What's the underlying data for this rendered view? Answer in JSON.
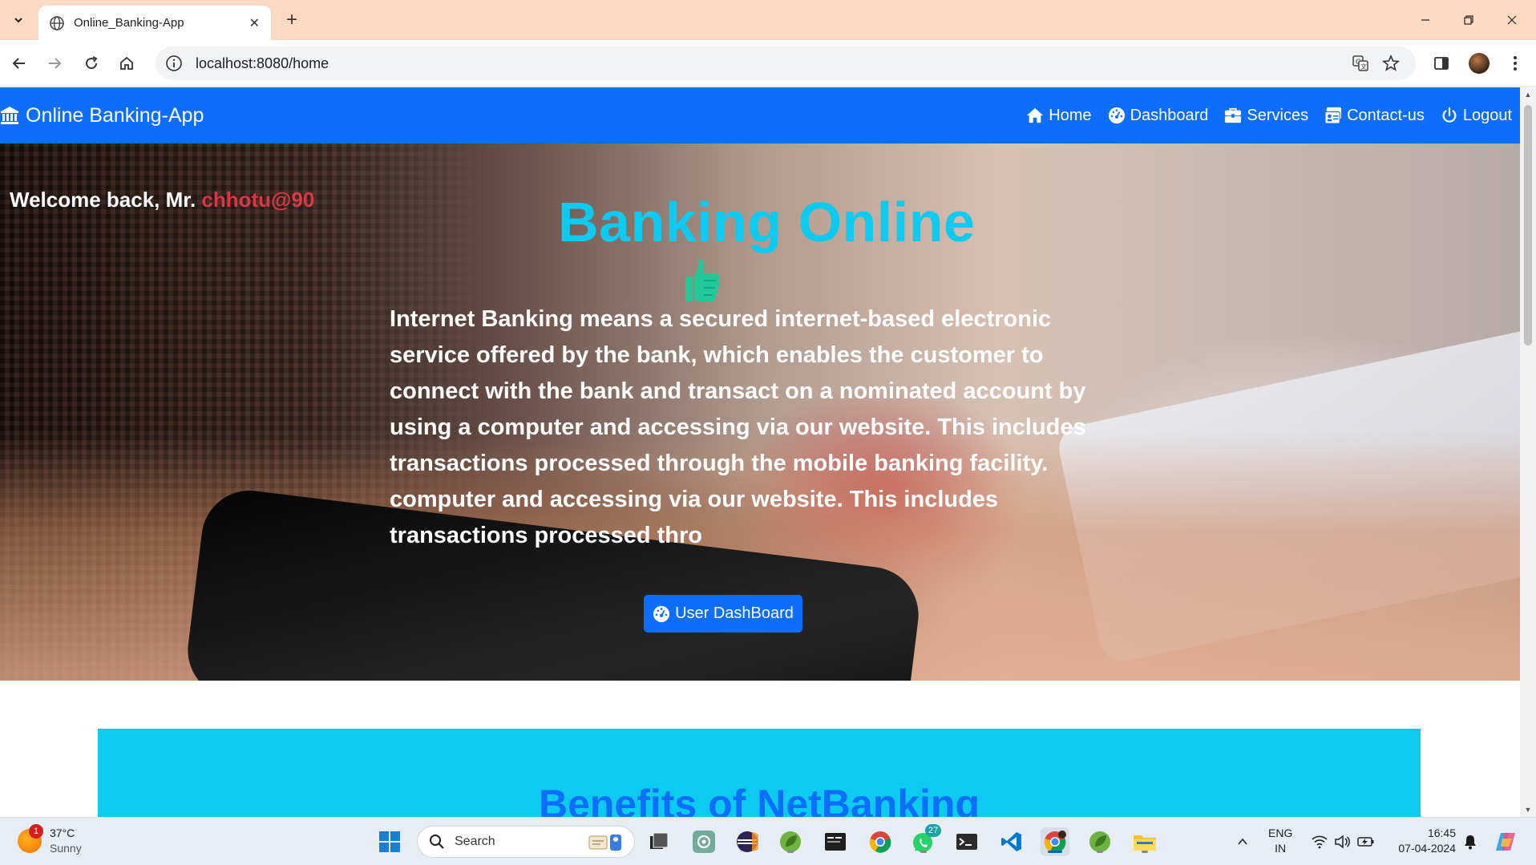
{
  "browser": {
    "tab_title": "Online_Banking-App",
    "url": "localhost:8080/home"
  },
  "navbar": {
    "brand": "Online Banking-App",
    "links": [
      {
        "label": "Home",
        "icon": "home-icon"
      },
      {
        "label": "Dashboard",
        "icon": "dashboard-gauge-icon"
      },
      {
        "label": "Services",
        "icon": "briefcase-icon"
      },
      {
        "label": "Contact-us",
        "icon": "address-card-icon"
      },
      {
        "label": "Logout",
        "icon": "power-icon"
      }
    ]
  },
  "hero": {
    "welcome_prefix": "Welcome back, Mr.",
    "username": "chhotu@90",
    "title": "Banking Online",
    "description": "Internet Banking means a secured internet-based electronic service offered by the bank, which enables the customer to connect with the bank and transact on a nominated account by using a computer and accessing via our website. This includes transactions processed through the mobile banking facility. computer and accessing via our website. This includes transactions processed thro",
    "button_label": "User DashBoard"
  },
  "benefits": {
    "title": "Benefits of NetBanking"
  },
  "taskbar": {
    "weather_temp": "37°C",
    "weather_desc": "Sunny",
    "weather_badge": "1",
    "search_label": "Search",
    "whatsapp_badge": "27",
    "lang_top": "ENG",
    "lang_bottom": "IN",
    "time": "16:45",
    "date": "07-04-2024"
  },
  "colors": {
    "primary": "#0d6efd",
    "info": "#0dcaf0",
    "danger": "#dc3545",
    "chrome_frame": "#fbd9c2"
  }
}
